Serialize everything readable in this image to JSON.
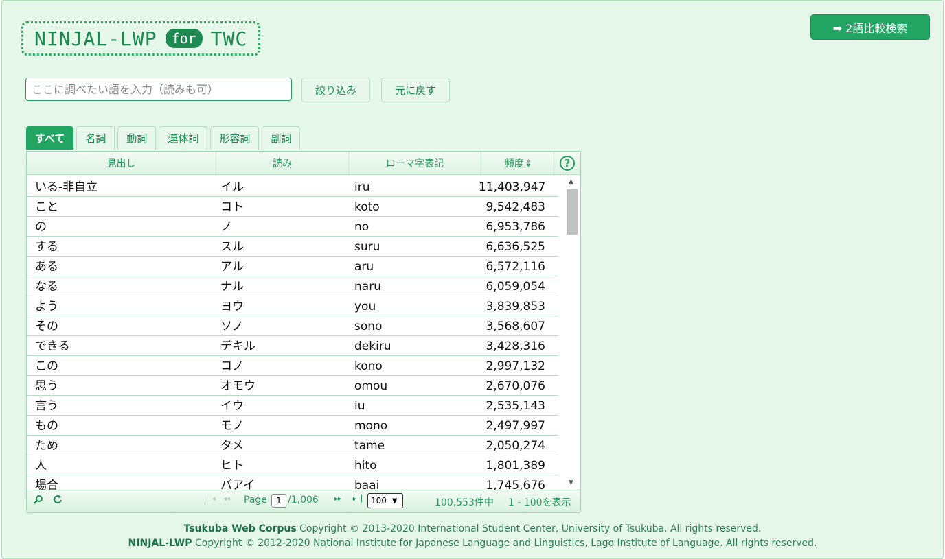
{
  "logo": {
    "part1": "NINJAL-LWP",
    "for": "for",
    "part2": "TWC"
  },
  "compare_button": {
    "label": "➡ 2語比較検索"
  },
  "search": {
    "placeholder": "ここに調べたい語を入力（読みも可）",
    "filter_label": "絞り込み",
    "reset_label": "元に戻す"
  },
  "tabs": [
    {
      "label": "すべて",
      "active": true
    },
    {
      "label": "名詞"
    },
    {
      "label": "動詞"
    },
    {
      "label": "連体詞"
    },
    {
      "label": "形容詞"
    },
    {
      "label": "副詞"
    }
  ],
  "grid": {
    "headers": {
      "headword": "見出し",
      "reading": "読み",
      "romaji": "ローマ字表記",
      "frequency": "頻度",
      "help": "?"
    },
    "rows": [
      {
        "headword": "いる-非自立",
        "reading": "イル",
        "romaji": "iru",
        "freq": "11,403,947"
      },
      {
        "headword": "こと",
        "reading": "コト",
        "romaji": "koto",
        "freq": "9,542,483"
      },
      {
        "headword": "の",
        "reading": "ノ",
        "romaji": "no",
        "freq": "6,953,786"
      },
      {
        "headword": "する",
        "reading": "スル",
        "romaji": "suru",
        "freq": "6,636,525"
      },
      {
        "headword": "ある",
        "reading": "アル",
        "romaji": "aru",
        "freq": "6,572,116"
      },
      {
        "headword": "なる",
        "reading": "ナル",
        "romaji": "naru",
        "freq": "6,059,054"
      },
      {
        "headword": "よう",
        "reading": "ヨウ",
        "romaji": "you",
        "freq": "3,839,853"
      },
      {
        "headword": "その",
        "reading": "ソノ",
        "romaji": "sono",
        "freq": "3,568,607"
      },
      {
        "headword": "できる",
        "reading": "デキル",
        "romaji": "dekiru",
        "freq": "3,428,316"
      },
      {
        "headword": "この",
        "reading": "コノ",
        "romaji": "kono",
        "freq": "2,997,132"
      },
      {
        "headword": "思う",
        "reading": "オモウ",
        "romaji": "omou",
        "freq": "2,670,076"
      },
      {
        "headword": "言う",
        "reading": "イウ",
        "romaji": "iu",
        "freq": "2,535,143"
      },
      {
        "headword": "もの",
        "reading": "モノ",
        "romaji": "mono",
        "freq": "2,497,997"
      },
      {
        "headword": "ため",
        "reading": "タメ",
        "romaji": "tame",
        "freq": "2,050,274"
      },
      {
        "headword": "人",
        "reading": "ヒト",
        "romaji": "hito",
        "freq": "1,801,389"
      },
      {
        "headword": "場合",
        "reading": "バアイ",
        "romaji": "baai",
        "freq": "1,745,676"
      }
    ],
    "pager": {
      "page_label": "Page",
      "current_page": "1",
      "total_pages": "/1,006",
      "page_size": "100",
      "total_count": "100,553件中",
      "range": "1 - 100を表示"
    }
  },
  "footer": {
    "line1_brand": "Tsukuba Web Corpus",
    "line1_text": " Copyright © 2013-2020 International Student Center, University of Tsukuba. All rights reserved.",
    "line2_brand": "NINJAL-LWP",
    "line2_text": " Copyright © 2012-2020 National Institute for Japanese Language and Linguistics, Lago Institute of Language. All rights reserved."
  },
  "colors": {
    "accent": "#22a463",
    "background": "#e4f7e8"
  }
}
